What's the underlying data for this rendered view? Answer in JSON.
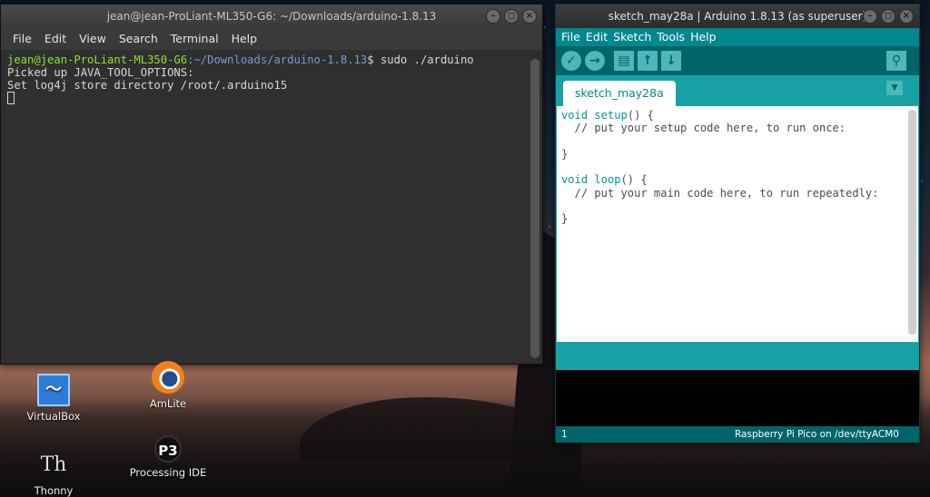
{
  "terminal": {
    "title": "jean@jean-ProLiant-ML350-G6: ~/Downloads/arduino-1.8.13",
    "menu": [
      "File",
      "Edit",
      "View",
      "Search",
      "Terminal",
      "Help"
    ],
    "prompt_user": "jean@jean-ProLiant-ML350-G6",
    "prompt_path": ":~/Downloads/arduino-1.8.13",
    "command": "$ sudo ./arduino",
    "line2": "Picked up JAVA_TOOL_OPTIONS:",
    "line3": "Set log4j store directory /root/.arduino15"
  },
  "arduino": {
    "title": "sketch_may28a | Arduino 1.8.13 (as superuser)",
    "menu": [
      "File",
      "Edit",
      "Sketch",
      "Tools",
      "Help"
    ],
    "toolbar_icons": [
      "verify-icon",
      "upload-icon",
      "new-icon",
      "open-icon",
      "save-icon",
      "serial-monitor-icon"
    ],
    "tab_label": "sketch_may28a",
    "code": {
      "l1_kw": "void",
      "l1_fn": "setup",
      "l1_rest": "() {",
      "l2": "  // put your setup code here, to run once:",
      "l4": "}",
      "l6_kw": "void",
      "l6_fn": "loop",
      "l6_rest": "() {",
      "l7": "  // put your main code here, to run repeatedly:",
      "l9": "}"
    },
    "status_line": "1",
    "status_board": "Raspberry Pi Pico on /dev/ttyACM0",
    "colors": {
      "teal": "#17a1a5",
      "dark_teal": "#006468",
      "menu_teal": "#00878f"
    }
  },
  "desktop": {
    "icons": [
      {
        "label": "VirtualBox",
        "icon": "virtualbox-icon"
      },
      {
        "label": "AmLite",
        "icon": "blender-icon"
      },
      {
        "label": "Processing IDE",
        "icon": "processing-icon"
      },
      {
        "label": "Thonny",
        "icon": "thonny-icon"
      }
    ]
  }
}
